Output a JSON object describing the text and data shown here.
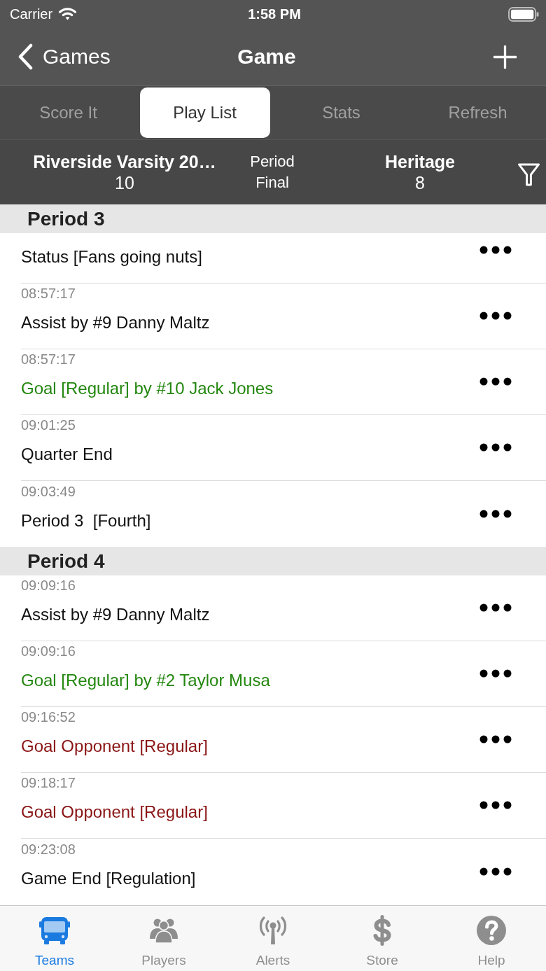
{
  "status_bar": {
    "carrier": "Carrier",
    "time": "1:58 PM"
  },
  "nav": {
    "back_label": "Games",
    "title": "Game"
  },
  "segments": [
    {
      "label": "Score It",
      "selected": false
    },
    {
      "label": "Play List",
      "selected": true
    },
    {
      "label": "Stats",
      "selected": false
    },
    {
      "label": "Refresh",
      "selected": false
    }
  ],
  "scoreboard": {
    "home": {
      "name": "Riverside Varsity 20…",
      "score": "10"
    },
    "period": {
      "label": "Period",
      "value": "Final"
    },
    "away": {
      "name": "Heritage",
      "score": "8"
    }
  },
  "sections": [
    {
      "title": "Period 3",
      "plays": [
        {
          "text": "Status [Fans going nuts]",
          "kind": "event"
        },
        {
          "time": "08:57:17",
          "text": "Assist by #9 Danny Maltz",
          "kind": "event"
        },
        {
          "time": "08:57:17",
          "text": "Goal [Regular] by #10 Jack Jones",
          "kind": "goal"
        },
        {
          "time": "09:01:25",
          "text": "Quarter End",
          "kind": "event"
        },
        {
          "time": "09:03:49",
          "text": "Period 3  [Fourth]",
          "kind": "event"
        }
      ]
    },
    {
      "title": "Period 4",
      "plays": [
        {
          "time": "09:09:16",
          "text": "Assist by #9 Danny Maltz",
          "kind": "event"
        },
        {
          "time": "09:09:16",
          "text": "Goal [Regular] by #2 Taylor Musa",
          "kind": "goal"
        },
        {
          "time": "09:16:52",
          "text": "Goal Opponent [Regular]",
          "kind": "opponent_goal"
        },
        {
          "time": "09:18:17",
          "text": "Goal Opponent [Regular]",
          "kind": "opponent_goal"
        },
        {
          "time": "09:23:08",
          "text": "Game End [Regulation]",
          "kind": "event"
        }
      ]
    }
  ],
  "tab_bar": [
    {
      "label": "Teams",
      "selected": true
    },
    {
      "label": "Players",
      "selected": false
    },
    {
      "label": "Alerts",
      "selected": false
    },
    {
      "label": "Store",
      "selected": false
    },
    {
      "label": "Help",
      "selected": false
    }
  ]
}
